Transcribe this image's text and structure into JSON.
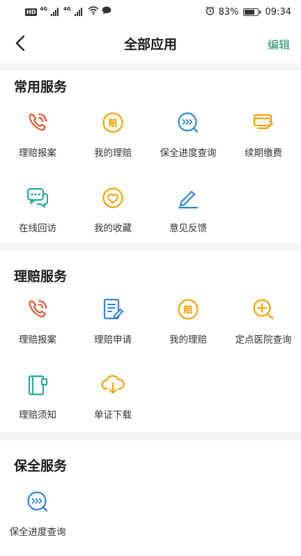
{
  "status_bar": {
    "left_badge": "HD",
    "network_1": "4G",
    "network_2": "4G",
    "battery_percent": "83%",
    "battery_level": 0.83,
    "time": "09:34"
  },
  "nav": {
    "title": "全部应用",
    "edit_label": "编辑"
  },
  "sections": [
    {
      "title": "常用服务",
      "items": [
        {
          "label": "理赔报案",
          "icon": "phone-call-icon",
          "color": "#e2572c"
        },
        {
          "label": "我的理赔",
          "icon": "claim-coin-icon",
          "color": "#f0a30a"
        },
        {
          "label": "保全进度查询",
          "icon": "progress-search-icon",
          "color": "#2f86d1"
        },
        {
          "label": "续期缴费",
          "icon": "renewal-payment-icon",
          "color": "#f0a30a"
        },
        {
          "label": "在线回访",
          "icon": "chat-bubbles-icon",
          "color": "#25a69a"
        },
        {
          "label": "我的收藏",
          "icon": "heart-icon",
          "color": "#f0a30a"
        },
        {
          "label": "意见反馈",
          "icon": "pencil-feedback-icon",
          "color": "#2f86d1"
        }
      ]
    },
    {
      "title": "理赔服务",
      "items": [
        {
          "label": "理赔报案",
          "icon": "phone-call-icon",
          "color": "#e2572c"
        },
        {
          "label": "理赔申请",
          "icon": "application-form-icon",
          "color": "#2f86d1"
        },
        {
          "label": "我的理赔",
          "icon": "claim-coin-icon",
          "color": "#f0a30a"
        },
        {
          "label": "定点医院查询",
          "icon": "hospital-search-icon",
          "color": "#f0a30a"
        },
        {
          "label": "理赔须知",
          "icon": "notice-book-icon",
          "color": "#25a69a"
        },
        {
          "label": "单证下载",
          "icon": "cloud-download-icon",
          "color": "#f0a30a"
        }
      ]
    },
    {
      "title": "保全服务",
      "items": [
        {
          "label": "保全进度查询",
          "icon": "progress-search-icon",
          "color": "#2f86d1"
        }
      ]
    }
  ]
}
